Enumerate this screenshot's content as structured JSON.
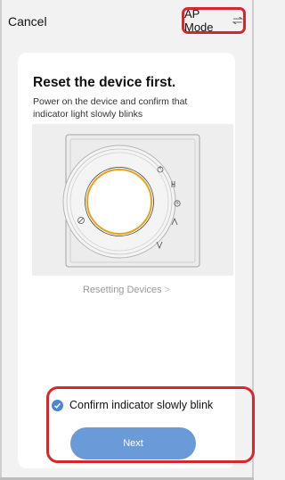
{
  "header": {
    "cancel_label": "Cancel",
    "mode_label": "AP Mode",
    "mode_icon": "swap-arrows-icon"
  },
  "card": {
    "title": "Reset the device first.",
    "description": "Power on the device and confirm that indicator light slowly blinks",
    "illustration": {
      "device_icon_names": [
        "power-icon",
        "fan-icon",
        "clock-icon",
        "up-icon",
        "down-icon",
        "lock-icon"
      ]
    },
    "reset_link_label": "Resetting Devices",
    "reset_link_chevron": ">"
  },
  "footer": {
    "confirm_label": "Confirm indicator slowly blink",
    "confirm_checked": true,
    "next_label": "Next"
  },
  "colors": {
    "accent": "#6b9ad8",
    "checkbox": "#4a86d4",
    "highlight": "#d9262b",
    "ring": "#e8a417",
    "background": "#f2f2f2"
  }
}
